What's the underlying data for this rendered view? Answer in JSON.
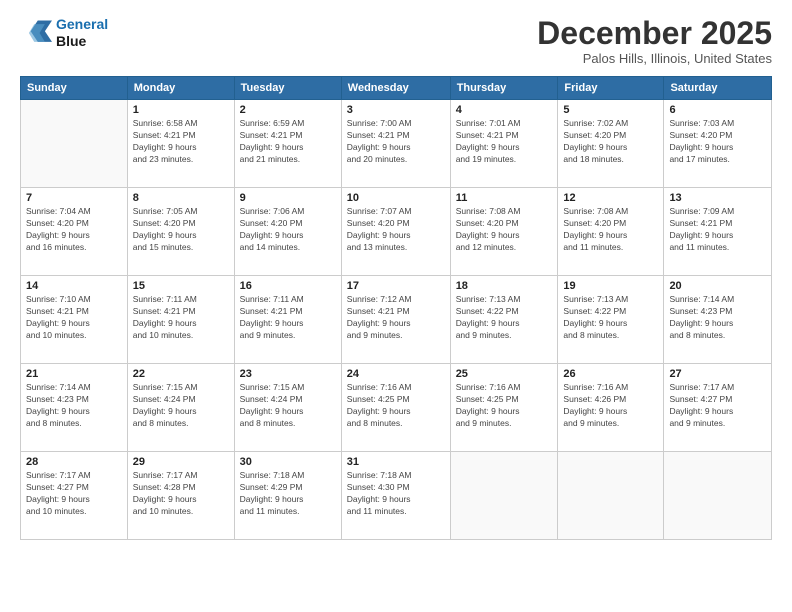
{
  "header": {
    "logo_line1": "General",
    "logo_line2": "Blue",
    "month": "December 2025",
    "location": "Palos Hills, Illinois, United States"
  },
  "weekdays": [
    "Sunday",
    "Monday",
    "Tuesday",
    "Wednesday",
    "Thursday",
    "Friday",
    "Saturday"
  ],
  "weeks": [
    [
      {
        "day": "",
        "info": ""
      },
      {
        "day": "1",
        "info": "Sunrise: 6:58 AM\nSunset: 4:21 PM\nDaylight: 9 hours\nand 23 minutes."
      },
      {
        "day": "2",
        "info": "Sunrise: 6:59 AM\nSunset: 4:21 PM\nDaylight: 9 hours\nand 21 minutes."
      },
      {
        "day": "3",
        "info": "Sunrise: 7:00 AM\nSunset: 4:21 PM\nDaylight: 9 hours\nand 20 minutes."
      },
      {
        "day": "4",
        "info": "Sunrise: 7:01 AM\nSunset: 4:21 PM\nDaylight: 9 hours\nand 19 minutes."
      },
      {
        "day": "5",
        "info": "Sunrise: 7:02 AM\nSunset: 4:20 PM\nDaylight: 9 hours\nand 18 minutes."
      },
      {
        "day": "6",
        "info": "Sunrise: 7:03 AM\nSunset: 4:20 PM\nDaylight: 9 hours\nand 17 minutes."
      }
    ],
    [
      {
        "day": "7",
        "info": "Sunrise: 7:04 AM\nSunset: 4:20 PM\nDaylight: 9 hours\nand 16 minutes."
      },
      {
        "day": "8",
        "info": "Sunrise: 7:05 AM\nSunset: 4:20 PM\nDaylight: 9 hours\nand 15 minutes."
      },
      {
        "day": "9",
        "info": "Sunrise: 7:06 AM\nSunset: 4:20 PM\nDaylight: 9 hours\nand 14 minutes."
      },
      {
        "day": "10",
        "info": "Sunrise: 7:07 AM\nSunset: 4:20 PM\nDaylight: 9 hours\nand 13 minutes."
      },
      {
        "day": "11",
        "info": "Sunrise: 7:08 AM\nSunset: 4:20 PM\nDaylight: 9 hours\nand 12 minutes."
      },
      {
        "day": "12",
        "info": "Sunrise: 7:08 AM\nSunset: 4:20 PM\nDaylight: 9 hours\nand 11 minutes."
      },
      {
        "day": "13",
        "info": "Sunrise: 7:09 AM\nSunset: 4:21 PM\nDaylight: 9 hours\nand 11 minutes."
      }
    ],
    [
      {
        "day": "14",
        "info": "Sunrise: 7:10 AM\nSunset: 4:21 PM\nDaylight: 9 hours\nand 10 minutes."
      },
      {
        "day": "15",
        "info": "Sunrise: 7:11 AM\nSunset: 4:21 PM\nDaylight: 9 hours\nand 10 minutes."
      },
      {
        "day": "16",
        "info": "Sunrise: 7:11 AM\nSunset: 4:21 PM\nDaylight: 9 hours\nand 9 minutes."
      },
      {
        "day": "17",
        "info": "Sunrise: 7:12 AM\nSunset: 4:21 PM\nDaylight: 9 hours\nand 9 minutes."
      },
      {
        "day": "18",
        "info": "Sunrise: 7:13 AM\nSunset: 4:22 PM\nDaylight: 9 hours\nand 9 minutes."
      },
      {
        "day": "19",
        "info": "Sunrise: 7:13 AM\nSunset: 4:22 PM\nDaylight: 9 hours\nand 8 minutes."
      },
      {
        "day": "20",
        "info": "Sunrise: 7:14 AM\nSunset: 4:23 PM\nDaylight: 9 hours\nand 8 minutes."
      }
    ],
    [
      {
        "day": "21",
        "info": "Sunrise: 7:14 AM\nSunset: 4:23 PM\nDaylight: 9 hours\nand 8 minutes."
      },
      {
        "day": "22",
        "info": "Sunrise: 7:15 AM\nSunset: 4:24 PM\nDaylight: 9 hours\nand 8 minutes."
      },
      {
        "day": "23",
        "info": "Sunrise: 7:15 AM\nSunset: 4:24 PM\nDaylight: 9 hours\nand 8 minutes."
      },
      {
        "day": "24",
        "info": "Sunrise: 7:16 AM\nSunset: 4:25 PM\nDaylight: 9 hours\nand 8 minutes."
      },
      {
        "day": "25",
        "info": "Sunrise: 7:16 AM\nSunset: 4:25 PM\nDaylight: 9 hours\nand 9 minutes."
      },
      {
        "day": "26",
        "info": "Sunrise: 7:16 AM\nSunset: 4:26 PM\nDaylight: 9 hours\nand 9 minutes."
      },
      {
        "day": "27",
        "info": "Sunrise: 7:17 AM\nSunset: 4:27 PM\nDaylight: 9 hours\nand 9 minutes."
      }
    ],
    [
      {
        "day": "28",
        "info": "Sunrise: 7:17 AM\nSunset: 4:27 PM\nDaylight: 9 hours\nand 10 minutes."
      },
      {
        "day": "29",
        "info": "Sunrise: 7:17 AM\nSunset: 4:28 PM\nDaylight: 9 hours\nand 10 minutes."
      },
      {
        "day": "30",
        "info": "Sunrise: 7:18 AM\nSunset: 4:29 PM\nDaylight: 9 hours\nand 11 minutes."
      },
      {
        "day": "31",
        "info": "Sunrise: 7:18 AM\nSunset: 4:30 PM\nDaylight: 9 hours\nand 11 minutes."
      },
      {
        "day": "",
        "info": ""
      },
      {
        "day": "",
        "info": ""
      },
      {
        "day": "",
        "info": ""
      }
    ]
  ]
}
